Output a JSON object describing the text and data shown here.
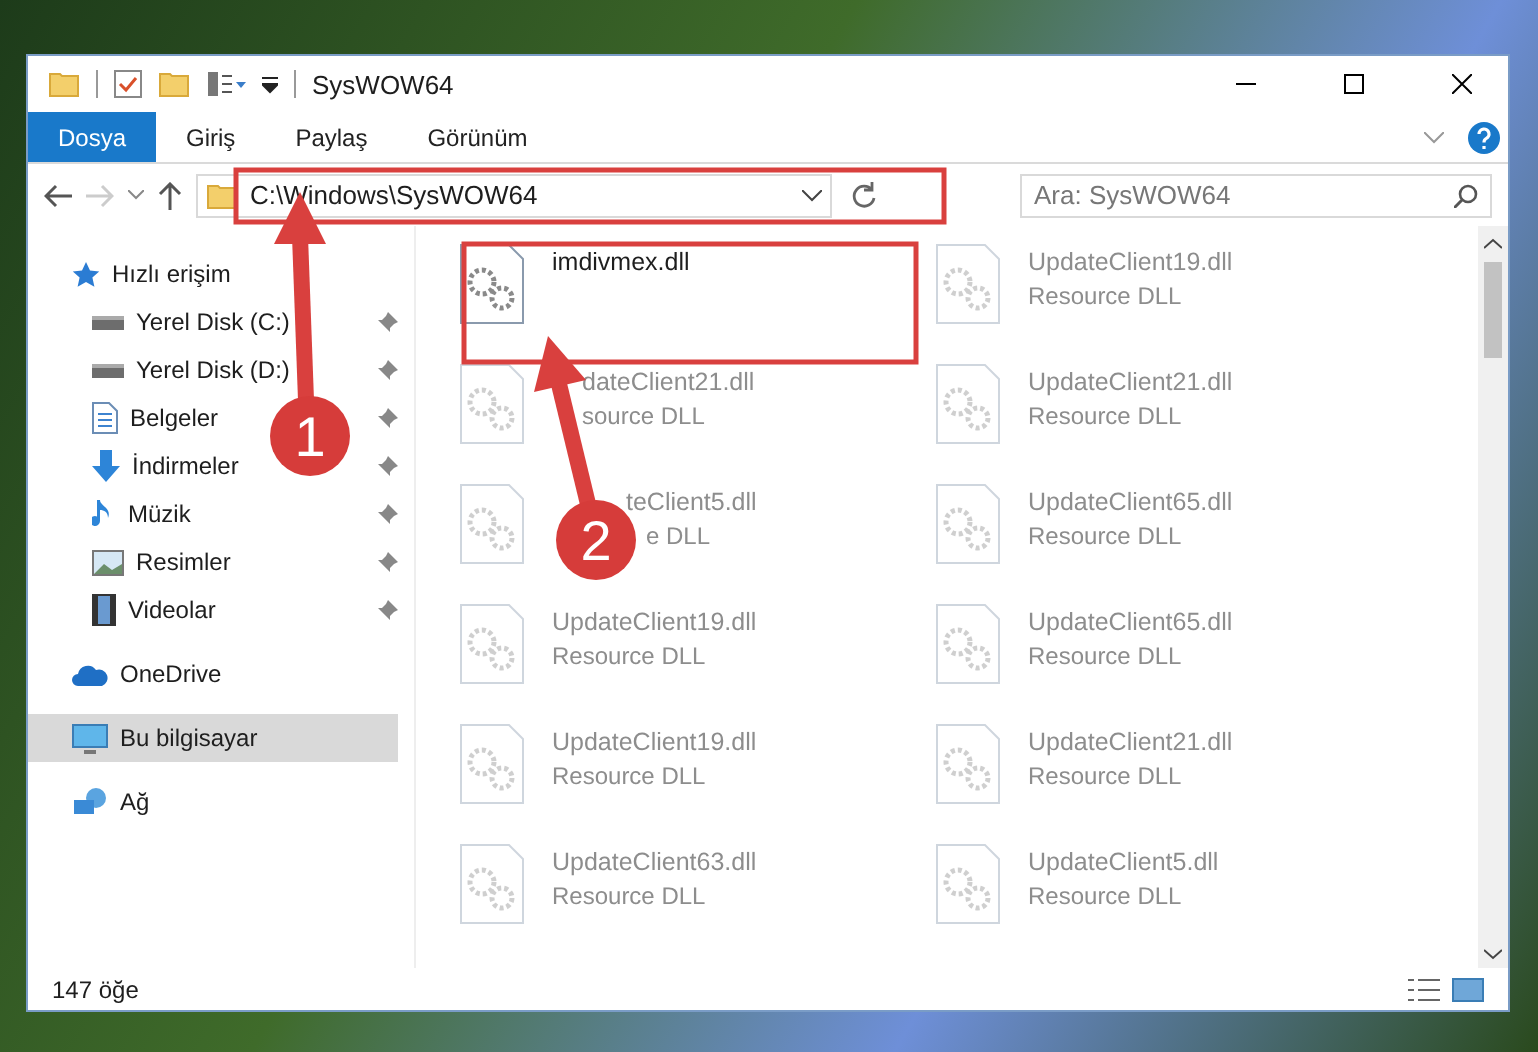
{
  "window": {
    "title": "SysWOW64"
  },
  "ribbon_tabs": [
    {
      "label": "Dosya",
      "selected": true
    },
    {
      "label": "Giriş",
      "selected": false
    },
    {
      "label": "Paylaş",
      "selected": false
    },
    {
      "label": "Görünüm",
      "selected": false
    }
  ],
  "address": {
    "path": "C:\\Windows\\SysWOW64"
  },
  "search": {
    "placeholder": "Ara: SysWOW64"
  },
  "sidebar": {
    "items": [
      {
        "label": "Hızlı erişim",
        "kind": "star",
        "selected": false,
        "children": [
          {
            "label": "Yerel Disk (C:)",
            "kind": "drive",
            "pinned": true
          },
          {
            "label": "Yerel Disk (D:)",
            "kind": "drive",
            "pinned": true
          },
          {
            "label": "Belgeler",
            "kind": "document",
            "pinned": true
          },
          {
            "label": "İndirmeler",
            "kind": "download",
            "pinned": true
          },
          {
            "label": "Müzik",
            "kind": "music",
            "pinned": true
          },
          {
            "label": "Resimler",
            "kind": "picture",
            "pinned": true
          },
          {
            "label": "Videolar",
            "kind": "video",
            "pinned": true
          }
        ]
      },
      {
        "label": "OneDrive",
        "kind": "cloud",
        "selected": false
      },
      {
        "label": "Bu bilgisayar",
        "kind": "computer",
        "selected": true
      },
      {
        "label": "Ağ",
        "kind": "network",
        "selected": false
      }
    ]
  },
  "files": [
    {
      "name": "imdivmex.dll",
      "dimmed": false
    },
    {
      "name": "UpdateClient19.dll",
      "type": "Resource DLL",
      "dimmed": true
    },
    {
      "name": "dateClient21.dll",
      "type": "source DLL",
      "dimmed": true
    },
    {
      "name": "UpdateClient21.dll",
      "type": "Resource DLL",
      "dimmed": true
    },
    {
      "name": "teClient5.dll",
      "type": "e DLL",
      "dimmed": true
    },
    {
      "name": "UpdateClient65.dll",
      "type": "Resource DLL",
      "dimmed": true
    },
    {
      "name": "UpdateClient19.dll",
      "type": "Resource DLL",
      "dimmed": true
    },
    {
      "name": "UpdateClient65.dll",
      "type": "Resource DLL",
      "dimmed": true
    },
    {
      "name": "UpdateClient19.dll",
      "type": "Resource DLL",
      "dimmed": true
    },
    {
      "name": "UpdateClient21.dll",
      "type": "Resource DLL",
      "dimmed": true
    },
    {
      "name": "UpdateClient63.dll",
      "type": "Resource DLL",
      "dimmed": true
    },
    {
      "name": "UpdateClient5.dll",
      "type": "Resource DLL",
      "dimmed": true
    }
  ],
  "status_bar": {
    "count": "147 öğe"
  },
  "annotations": [
    {
      "number": "1"
    },
    {
      "number": "2"
    }
  ]
}
